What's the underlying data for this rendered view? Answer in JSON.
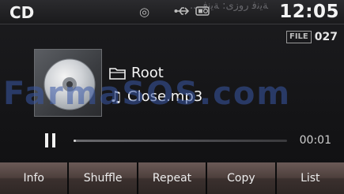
{
  "status_bar": {
    "source": "CD",
    "clock": "12:05",
    "watermark": "... ﺔﯾﻧﻓ روﺯی: ﺔﯾﻧﻓ",
    "icons": [
      "disc-icon",
      "usb-icon",
      "ipod-icon"
    ]
  },
  "file_info": {
    "badge": "FILE",
    "number": "027"
  },
  "playback": {
    "folder": "Root",
    "track": "Close.mp3",
    "elapsed": "00:01",
    "progress_fraction": 0.01,
    "state": "paused"
  },
  "watermark": "FarmaSOS.com",
  "softkeys": [
    "Info",
    "Shuffle",
    "Repeat",
    "Copy",
    "List"
  ],
  "colors": {
    "background": "#151517",
    "softkey": "#4d3f3c",
    "watermark": "#3a58a6"
  }
}
